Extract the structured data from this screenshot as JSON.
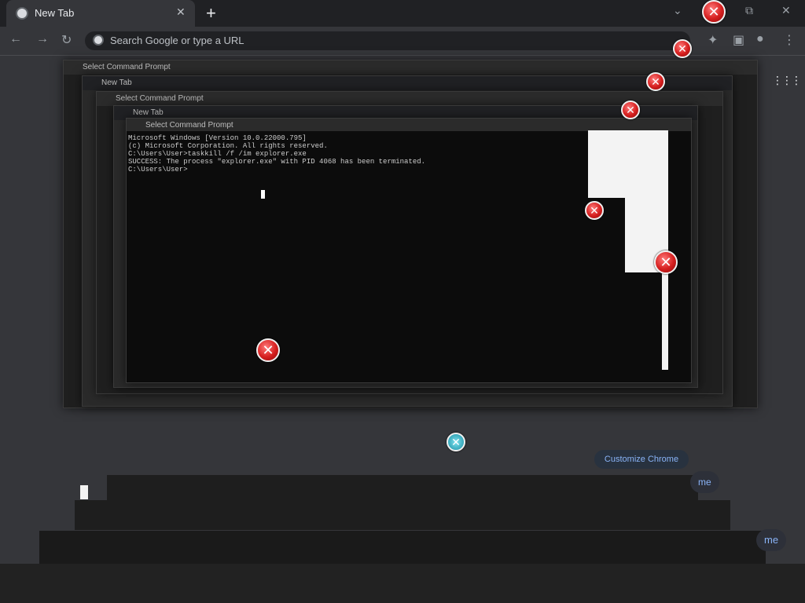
{
  "browser": {
    "tab_title": "New Tab",
    "tab_close": "✕",
    "new_tab": "+",
    "omnibox_placeholder": "Search Google or type a URL",
    "nav_back": "←",
    "nav_forward": "→",
    "nav_reload": "↻",
    "win_minimize": "—",
    "win_restore": "⧉",
    "win_close": "✕",
    "menu": "⋮",
    "apps": "⋮⋮⋮",
    "customize_label": "Customize Chrome"
  },
  "windows": [
    {
      "title": "Select Command Prompt"
    },
    {
      "title": "New Tab"
    },
    {
      "title": "Select Command Prompt"
    },
    {
      "title": "New Tab"
    },
    {
      "title": "Select Command Prompt"
    }
  ],
  "console": {
    "lines": [
      "Microsoft Windows [Version 10.0.22000.795]",
      "(c) Microsoft Corporation. All rights reserved.",
      "",
      "C:\\Users\\User>taskkill /f /im explorer.exe",
      "SUCCESS: The process \"explorer.exe\" with PID 4068 has been terminated.",
      "",
      "C:\\Users\\User>"
    ]
  },
  "dialog_error_symbol": "✕",
  "bottom_pills": [
    "me",
    "me"
  ],
  "colors": {
    "error_red": "#d61f1f",
    "console_bg": "#0c0c0c",
    "chrome_dark": "#202124",
    "link_blue": "#8ab4f8"
  }
}
